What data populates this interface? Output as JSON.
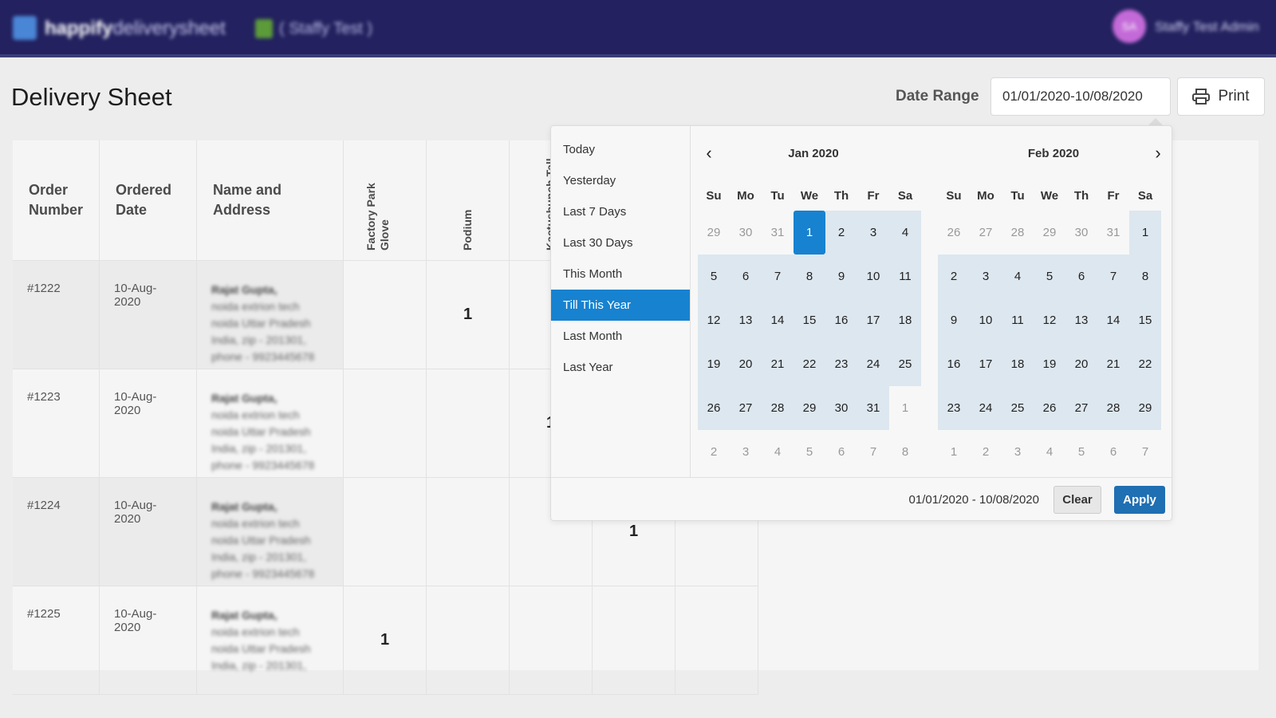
{
  "topbar": {
    "brand_bold": "happify",
    "brand_light": "deliverysheet",
    "store_name": "( Staffy Test )",
    "avatar_initials": "SA",
    "admin_name": "Staffy Test Admin"
  },
  "page": {
    "title": "Delivery Sheet",
    "date_range_label": "Date Range",
    "date_range_value": "01/01/2020-10/08/2020",
    "print_label": "Print"
  },
  "table": {
    "headers": [
      "Order Number",
      "Ordered Date",
      "Name and Address"
    ],
    "product_headers": [
      "Factory Park Glove",
      "Podium",
      "Kactusbunch Tall",
      "",
      ""
    ],
    "rows": [
      {
        "order": "#1222",
        "date": "10-Aug-2020",
        "name": "Rajat Gupta,",
        "address": "noida extrion tech noida Uttar Pradesh India, zip - 201301, phone - 9923445678",
        "qty": [
          "",
          "1",
          "",
          "",
          ""
        ]
      },
      {
        "order": "#1223",
        "date": "10-Aug-2020",
        "name": "Rajat Gupta,",
        "address": "noida extrion tech noida Uttar Pradesh India, zip - 201301, phone - 9923445678",
        "qty": [
          "",
          "",
          "1",
          "",
          ""
        ]
      },
      {
        "order": "#1224",
        "date": "10-Aug-2020",
        "name": "Rajat Gupta,",
        "address": "noida extrion tech noida Uttar Pradesh India, zip - 201301, phone - 9923445678",
        "qty": [
          "",
          "",
          "",
          "1",
          ""
        ]
      },
      {
        "order": "#1225",
        "date": "10-Aug-2020",
        "name": "Rajat Gupta,",
        "address": "noida extrion tech noida Uttar Pradesh India, zip - 201301,",
        "qty": [
          "1",
          "",
          "",
          "",
          ""
        ]
      }
    ]
  },
  "picker": {
    "ranges": [
      "Today",
      "Yesterday",
      "Last 7 Days",
      "Last 30 Days",
      "This Month",
      "Till This Year",
      "Last Month",
      "Last Year"
    ],
    "active_range": "Till This Year",
    "weekdays": [
      "Su",
      "Mo",
      "Tu",
      "We",
      "Th",
      "Fr",
      "Sa"
    ],
    "months": [
      {
        "title": "Jan 2020",
        "days": [
          [
            "29",
            "off"
          ],
          [
            "30",
            "off"
          ],
          [
            "31",
            "off"
          ],
          [
            "1",
            "selected"
          ],
          [
            "2",
            "in"
          ],
          [
            "3",
            "in"
          ],
          [
            "4",
            "in"
          ],
          [
            "5",
            "in"
          ],
          [
            "6",
            "in"
          ],
          [
            "7",
            "in"
          ],
          [
            "8",
            "in"
          ],
          [
            "9",
            "in"
          ],
          [
            "10",
            "in"
          ],
          [
            "11",
            "in"
          ],
          [
            "12",
            "in"
          ],
          [
            "13",
            "in"
          ],
          [
            "14",
            "in"
          ],
          [
            "15",
            "in"
          ],
          [
            "16",
            "in"
          ],
          [
            "17",
            "in"
          ],
          [
            "18",
            "in"
          ],
          [
            "19",
            "in"
          ],
          [
            "20",
            "in"
          ],
          [
            "21",
            "in"
          ],
          [
            "22",
            "in"
          ],
          [
            "23",
            "in"
          ],
          [
            "24",
            "in"
          ],
          [
            "25",
            "in"
          ],
          [
            "26",
            "in"
          ],
          [
            "27",
            "in"
          ],
          [
            "28",
            "in"
          ],
          [
            "29",
            "in"
          ],
          [
            "30",
            "in"
          ],
          [
            "31",
            "in"
          ],
          [
            "1",
            "off"
          ],
          [
            "2",
            "off"
          ],
          [
            "3",
            "off"
          ],
          [
            "4",
            "off"
          ],
          [
            "5",
            "off"
          ],
          [
            "6",
            "off"
          ],
          [
            "7",
            "off"
          ],
          [
            "8",
            "off"
          ]
        ]
      },
      {
        "title": "Feb 2020",
        "days": [
          [
            "26",
            "off"
          ],
          [
            "27",
            "off"
          ],
          [
            "28",
            "off"
          ],
          [
            "29",
            "off"
          ],
          [
            "30",
            "off"
          ],
          [
            "31",
            "off"
          ],
          [
            "1",
            "in"
          ],
          [
            "2",
            "in"
          ],
          [
            "3",
            "in"
          ],
          [
            "4",
            "in"
          ],
          [
            "5",
            "in"
          ],
          [
            "6",
            "in"
          ],
          [
            "7",
            "in"
          ],
          [
            "8",
            "in"
          ],
          [
            "9",
            "in"
          ],
          [
            "10",
            "in"
          ],
          [
            "11",
            "in"
          ],
          [
            "12",
            "in"
          ],
          [
            "13",
            "in"
          ],
          [
            "14",
            "in"
          ],
          [
            "15",
            "in"
          ],
          [
            "16",
            "in"
          ],
          [
            "17",
            "in"
          ],
          [
            "18",
            "in"
          ],
          [
            "19",
            "in"
          ],
          [
            "20",
            "in"
          ],
          [
            "21",
            "in"
          ],
          [
            "22",
            "in"
          ],
          [
            "23",
            "in"
          ],
          [
            "24",
            "in"
          ],
          [
            "25",
            "in"
          ],
          [
            "26",
            "in"
          ],
          [
            "27",
            "in"
          ],
          [
            "28",
            "in"
          ],
          [
            "29",
            "in"
          ],
          [
            "1",
            "off"
          ],
          [
            "2",
            "off"
          ],
          [
            "3",
            "off"
          ],
          [
            "4",
            "off"
          ],
          [
            "5",
            "off"
          ],
          [
            "6",
            "off"
          ],
          [
            "7",
            "off"
          ]
        ]
      }
    ],
    "footer_range": "01/01/2020 - 10/08/2020",
    "clear_label": "Clear",
    "apply_label": "Apply"
  },
  "icons": {
    "nav_prev": "chevron-left-icon",
    "nav_next": "chevron-right-icon",
    "print": "printer-icon"
  },
  "colors": {
    "topbar": "#23215f",
    "accent": "#1782d0",
    "apply": "#1f6fb3",
    "in_range": "#dde7ef"
  }
}
